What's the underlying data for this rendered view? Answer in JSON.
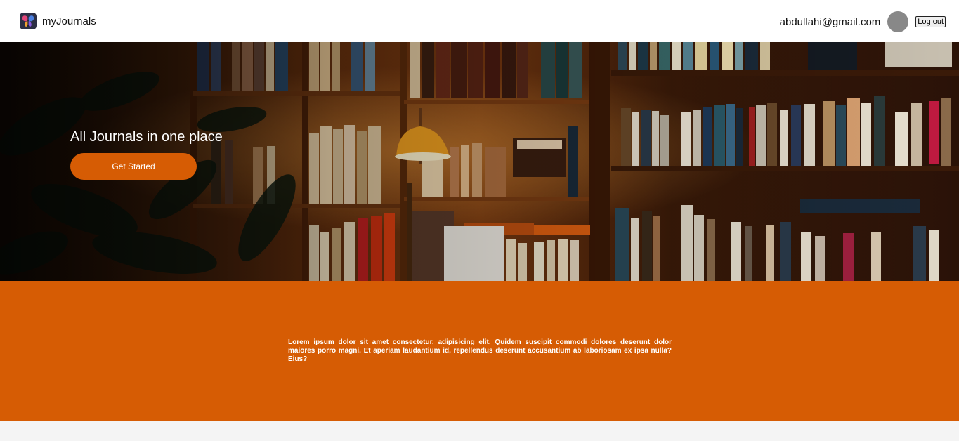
{
  "header": {
    "brand_name": "myJournals",
    "logo_icon": "butterfly-icon",
    "user_email": "abdullahi@gmail.com",
    "logout_label": "Log out"
  },
  "hero": {
    "title": "All Journals in one place",
    "cta_label": "Get Started",
    "background": "bookshelf-library-photo"
  },
  "about": {
    "text": "Lorem ipsum dolor sit amet consectetur, adipisicing elit. Quidem suscipit commodi dolores deserunt dolor maiores porro magni. Et aperiam laudantium id, repellendus deserunt accusantium ab laboriosam ex ipsa nulla? Eius?"
  },
  "colors": {
    "accent": "#d65c04",
    "header_bg": "#ffffff",
    "page_bg": "#f4f4f4",
    "avatar": "#888888"
  }
}
